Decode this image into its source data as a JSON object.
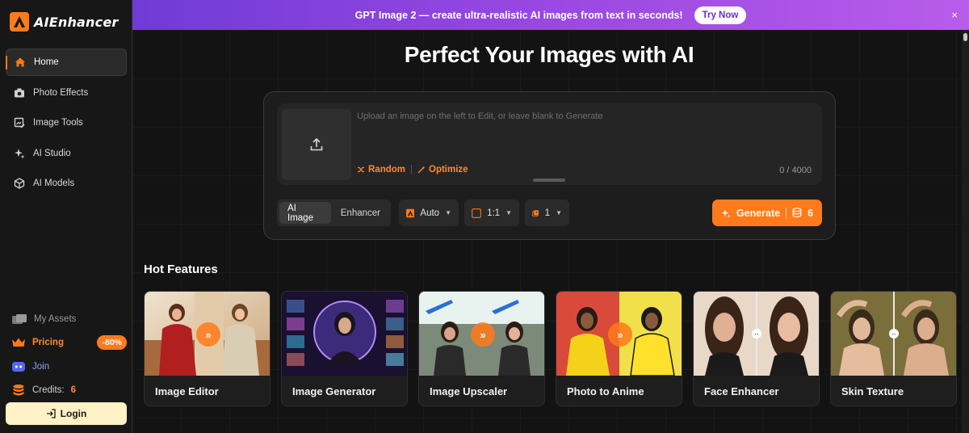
{
  "brand": {
    "name": "AIEnhancer",
    "accent": "#ff7a1a"
  },
  "sidebar": {
    "items": [
      {
        "label": "Home",
        "icon": "home-icon",
        "active": true
      },
      {
        "label": "Photo Effects",
        "icon": "camera-icon"
      },
      {
        "label": "Image Tools",
        "icon": "edit-image-icon"
      },
      {
        "label": "AI Studio",
        "icon": "sparkle-icon"
      },
      {
        "label": "AI Models",
        "icon": "cube-icon"
      }
    ],
    "bottom": {
      "assets": "My Assets",
      "pricing": "Pricing",
      "discount": "-80%",
      "join": "Join",
      "credits_label": "Credits:",
      "credits_value": "6"
    },
    "login": "Login"
  },
  "banner": {
    "text": "GPT Image 2 — create ultra-realistic AI images from text in seconds!",
    "cta": "Try Now",
    "close": "×"
  },
  "main": {
    "title": "Perfect Your Images with AI",
    "prompt": {
      "placeholder": "Upload an image on the left to Edit, or leave blank to Generate",
      "random": "Random",
      "separator": "|",
      "optimize": "Optimize",
      "counter": "0 / 4000"
    },
    "modes": [
      {
        "label": "AI Image",
        "active": true
      },
      {
        "label": "Enhancer",
        "active": false
      }
    ],
    "model": "Auto",
    "ratio": "1:1",
    "count": "1",
    "generate": {
      "label": "Generate",
      "credits": "6"
    },
    "hot_title": "Hot Features",
    "features": [
      {
        "label": "Image Editor"
      },
      {
        "label": "Image Generator"
      },
      {
        "label": "Image Upscaler"
      },
      {
        "label": "Photo to Anime"
      },
      {
        "label": "Face Enhancer"
      },
      {
        "label": "Skin Texture"
      }
    ]
  }
}
